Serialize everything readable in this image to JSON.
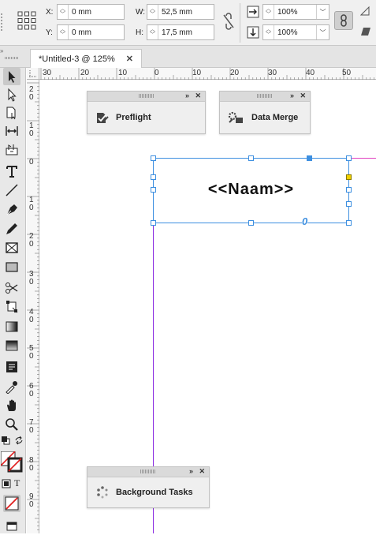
{
  "control_bar": {
    "x_label": "X:",
    "x_value": "0 mm",
    "y_label": "Y:",
    "y_value": "0 mm",
    "w_label": "W:",
    "w_value": "52,5 mm",
    "h_label": "H:",
    "h_value": "17,5 mm",
    "scale_x_value": "100%",
    "scale_y_value": "100%"
  },
  "document_tab": {
    "title": "*Untitled-3 @ 125%",
    "close": "✕"
  },
  "ruler": {
    "horizontal": [
      "30",
      "20",
      "10",
      "0",
      "10",
      "20",
      "30",
      "40",
      "50"
    ],
    "vertical": [
      "2\n0",
      "1\n0",
      "0",
      "1\n0",
      "2\n0",
      "3\n0",
      "4\n0",
      "5\n0",
      "6\n0",
      "7\n0",
      "8\n0",
      "9\n0"
    ]
  },
  "panels": {
    "preflight": {
      "label": "Preflight",
      "collapse": "»",
      "close": "✕"
    },
    "data_merge": {
      "label": "Data Merge",
      "collapse": "»",
      "close": "✕"
    },
    "background_tasks": {
      "label": "Background Tasks",
      "collapse": "»",
      "close": "✕"
    }
  },
  "text_frame": {
    "content": "<<Naam>>",
    "overflow_marker": "0"
  },
  "colors": {
    "frame_selection": "#3d8fe0",
    "guide_purple": "#8a2be2",
    "guide_magenta": "#e040c0",
    "anchor_yellow": "#f0d000"
  }
}
